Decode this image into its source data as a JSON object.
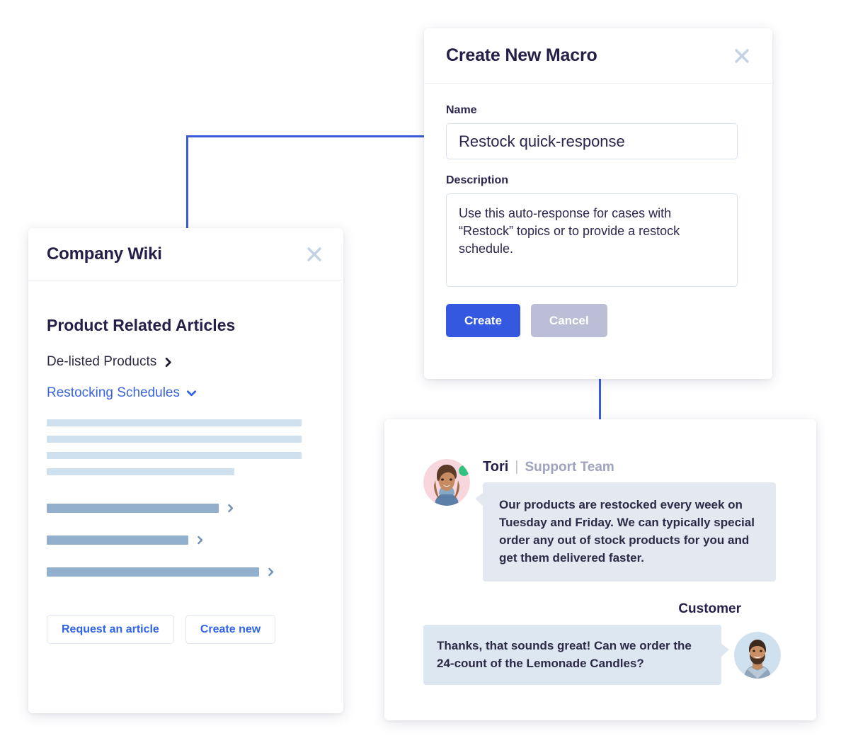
{
  "connectors": {
    "wiki_to_macro": "elbow-connector",
    "macro_to_chat": "vertical-connector"
  },
  "macro_dialog": {
    "title": "Create New Macro",
    "close_icon": "close-icon",
    "name": {
      "label": "Name",
      "value": "Restock quick-response"
    },
    "description": {
      "label": "Description",
      "value": "Use this auto-response for cases with “Restock” topics or to provide a restock schedule."
    },
    "create_label": "Create",
    "cancel_label": "Cancel",
    "create_color": "#3558e0",
    "cancel_color": "#bcbdd6"
  },
  "wiki_panel": {
    "title": "Company Wiki",
    "close_icon": "close-icon",
    "section_title": "Product Related Articles",
    "links": [
      {
        "label": "De-listed Products",
        "icon": "chevron-right-icon",
        "state": "collapsed"
      },
      {
        "label": "Restocking Schedules",
        "icon": "chevron-down-icon",
        "state": "expanded"
      }
    ],
    "skeleton_light": [
      360,
      360,
      360,
      265
    ],
    "skeleton_dark": [
      243,
      200,
      300
    ],
    "footer": {
      "request_label": "Request an article",
      "create_label": "Create new"
    },
    "link_color": "#3a63e0"
  },
  "chat_panel": {
    "messages": [
      {
        "sender": "Tori",
        "separator": "|",
        "role": "Support Team",
        "status": "online",
        "avatar": "agent-avatar",
        "text": "Our products are restocked every week on Tuesday and Friday. We can typically special order any out of stock products for you and get them delivered faster."
      },
      {
        "sender": "Customer",
        "avatar": "customer-avatar",
        "text": "Thanks, that sounds great! Can we order the 24-count of the Lemonade Candles?"
      }
    ],
    "status_color": "#33c17f"
  }
}
